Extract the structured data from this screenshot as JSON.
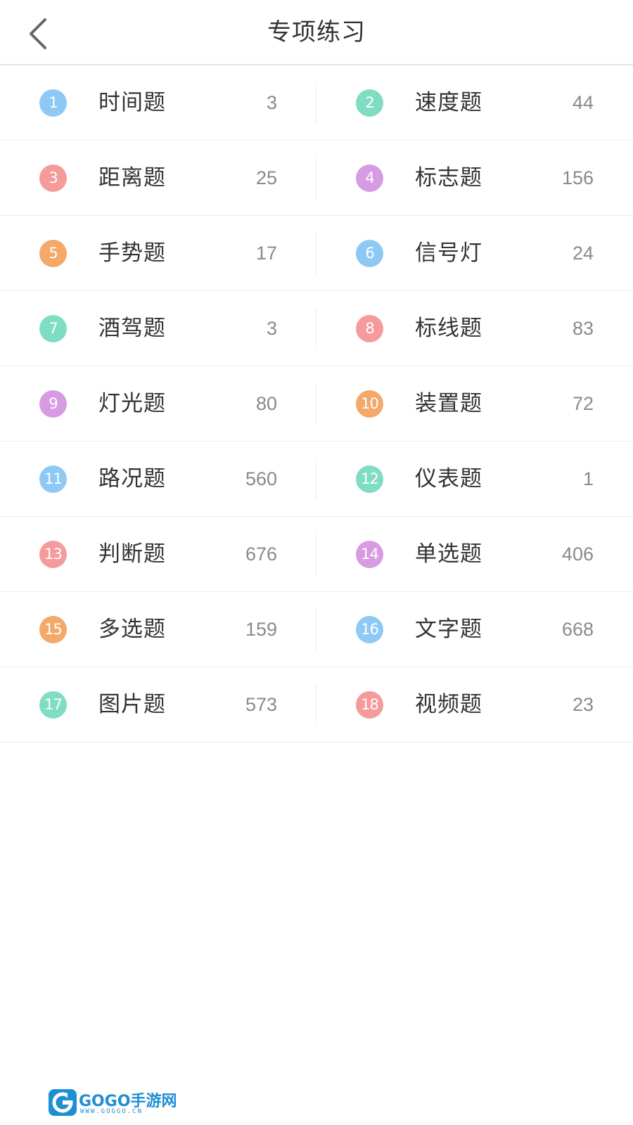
{
  "header": {
    "title": "专项练习",
    "back_icon": "chevron-left-icon"
  },
  "categories": [
    {
      "num": "1",
      "label": "时间题",
      "count": "3",
      "color": "#8ec9f5"
    },
    {
      "num": "2",
      "label": "速度题",
      "count": "44",
      "color": "#7fddc3"
    },
    {
      "num": "3",
      "label": "距离题",
      "count": "25",
      "color": "#f59b9b"
    },
    {
      "num": "4",
      "label": "标志题",
      "count": "156",
      "color": "#d79be3"
    },
    {
      "num": "5",
      "label": "手势题",
      "count": "17",
      "color": "#f4a86a"
    },
    {
      "num": "6",
      "label": "信号灯",
      "count": "24",
      "color": "#8ec9f5"
    },
    {
      "num": "7",
      "label": "酒驾题",
      "count": "3",
      "color": "#7fddc3"
    },
    {
      "num": "8",
      "label": "标线题",
      "count": "83",
      "color": "#f59b9b"
    },
    {
      "num": "9",
      "label": "灯光题",
      "count": "80",
      "color": "#d79be3"
    },
    {
      "num": "10",
      "label": "装置题",
      "count": "72",
      "color": "#f4a86a"
    },
    {
      "num": "11",
      "label": "路况题",
      "count": "560",
      "color": "#8ec9f5"
    },
    {
      "num": "12",
      "label": "仪表题",
      "count": "1",
      "color": "#7fddc3"
    },
    {
      "num": "13",
      "label": "判断题",
      "count": "676",
      "color": "#f59b9b"
    },
    {
      "num": "14",
      "label": "单选题",
      "count": "406",
      "color": "#d79be3"
    },
    {
      "num": "15",
      "label": "多选题",
      "count": "159",
      "color": "#f4a86a"
    },
    {
      "num": "16",
      "label": "文字题",
      "count": "668",
      "color": "#8ec9f5"
    },
    {
      "num": "17",
      "label": "图片题",
      "count": "573",
      "color": "#7fddc3"
    },
    {
      "num": "18",
      "label": "视频题",
      "count": "23",
      "color": "#f59b9b"
    }
  ],
  "watermark": {
    "text": "GOGO手游网",
    "sub": "WWW.GOGGO.CN",
    "icon": "gogo-logo-icon"
  }
}
